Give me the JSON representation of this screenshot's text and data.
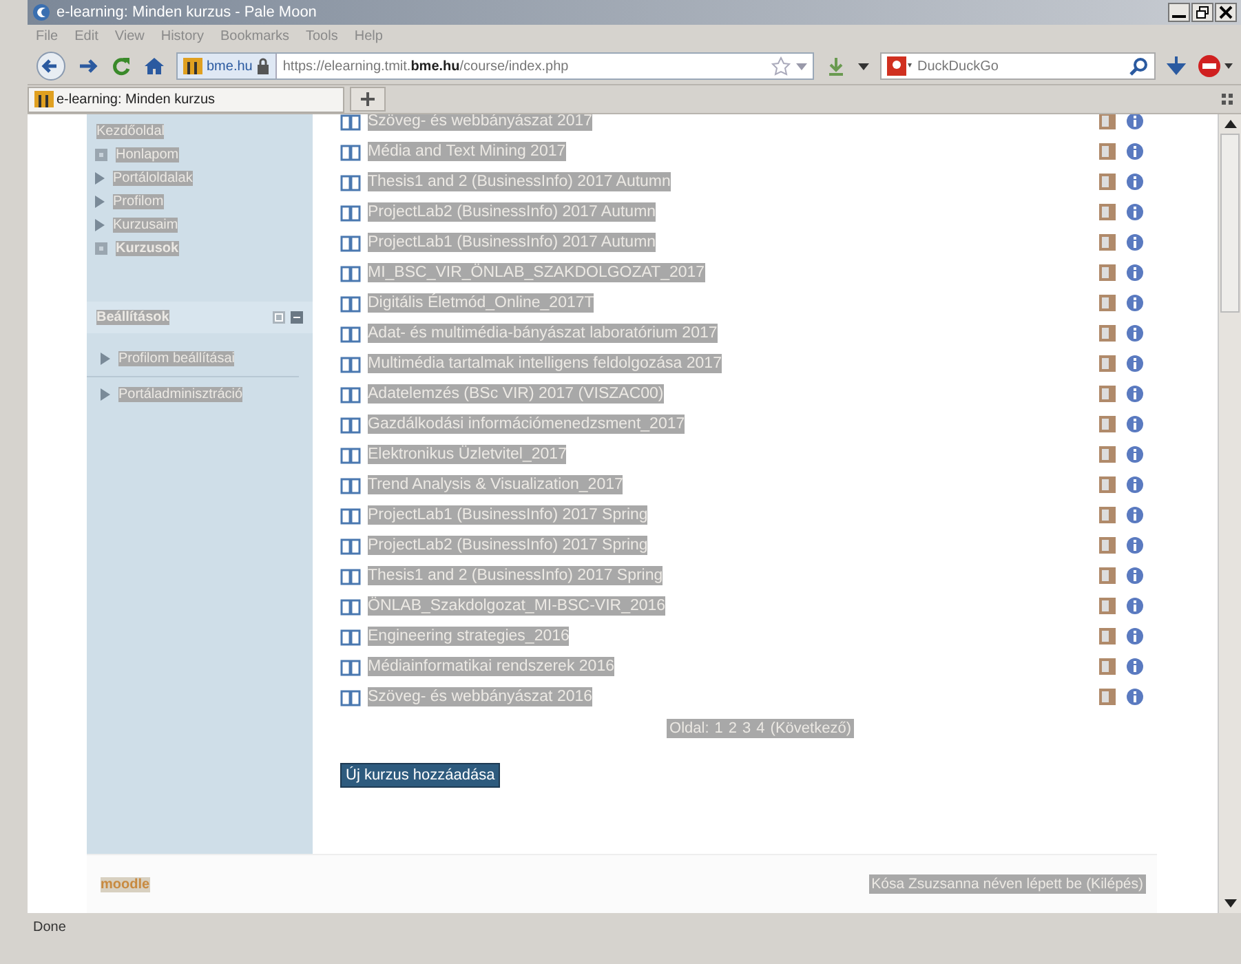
{
  "window": {
    "title": "e-learning: Minden kurzus - Pale Moon"
  },
  "menu": [
    "File",
    "Edit",
    "View",
    "History",
    "Bookmarks",
    "Tools",
    "Help"
  ],
  "toolbar": {
    "site": "bme.hu",
    "url_prefix": "https://elearning.tmit.",
    "url_domain": "bme.hu",
    "url_path": "/course/index.php",
    "search_engine": "DuckDuckGo"
  },
  "tabs": [
    {
      "label": "e-learning: Minden kurzus",
      "selected": true
    }
  ],
  "sidebar": {
    "navigation_title": "Kezdőoldal",
    "items": [
      {
        "label": "Honlapom",
        "kind": "leaf",
        "current": false
      },
      {
        "label": "Portáloldalak",
        "kind": "branch",
        "current": false
      },
      {
        "label": "Profilom",
        "kind": "branch",
        "current": false
      },
      {
        "label": "Kurzusaim",
        "kind": "branch",
        "current": false
      },
      {
        "label": "Kurzusok",
        "kind": "leaf",
        "current": true
      }
    ],
    "settings_title": "Beállítások",
    "settings_items": [
      "Profilom beállításai",
      "Portáladminisztráció"
    ]
  },
  "courses": [
    {
      "name": "Szöveg- és webbányászat 2017"
    },
    {
      "name": "Média and Text Mining 2017"
    },
    {
      "name": "Thesis1 and 2 (BusinessInfo) 2017 Autumn"
    },
    {
      "name": "ProjectLab2 (BusinessInfo) 2017 Autumn"
    },
    {
      "name": "ProjectLab1 (BusinessInfo) 2017 Autumn"
    },
    {
      "name": "MI_BSC_VIR_ÖNLAB_SZAKDOLGOZAT_2017"
    },
    {
      "name": "Digitális Életmód_Online_2017T"
    },
    {
      "name": "Adat- és multimédia-bányászat laboratórium 2017"
    },
    {
      "name": "Multimédia tartalmak intelligens feldolgozása 2017"
    },
    {
      "name": "Adatelemzés (BSc VIR) 2017 (VISZAC00)"
    },
    {
      "name": "Gazdálkodási információmenedzsment_2017"
    },
    {
      "name": "Elektronikus Üzletvitel_2017"
    },
    {
      "name": "Trend Analysis & Visualization_2017"
    },
    {
      "name": "ProjectLab1 (BusinessInfo) 2017 Spring"
    },
    {
      "name": "ProjectLab2 (BusinessInfo) 2017 Spring"
    },
    {
      "name": "Thesis1 and 2 (BusinessInfo) 2017 Spring"
    },
    {
      "name": "ÖNLAB_Szakdolgozat_MI-BSC-VIR_2016"
    },
    {
      "name": "Engineering strategies_2016"
    },
    {
      "name": "Médiainformatikai rendszerek 2016"
    },
    {
      "name": "Szöveg- és webbányászat 2016"
    }
  ],
  "pagination": {
    "label": "Oldal:",
    "pages": [
      "1",
      "2",
      "3",
      "4"
    ],
    "next": "(Következő)"
  },
  "add_button": "Új kurzus hozzáadása",
  "footer": {
    "logo": "moodle",
    "login_text": "Kósa Zsuzsanna néven lépett be",
    "logout": "(Kilépés)"
  },
  "status_bar": "Done"
}
